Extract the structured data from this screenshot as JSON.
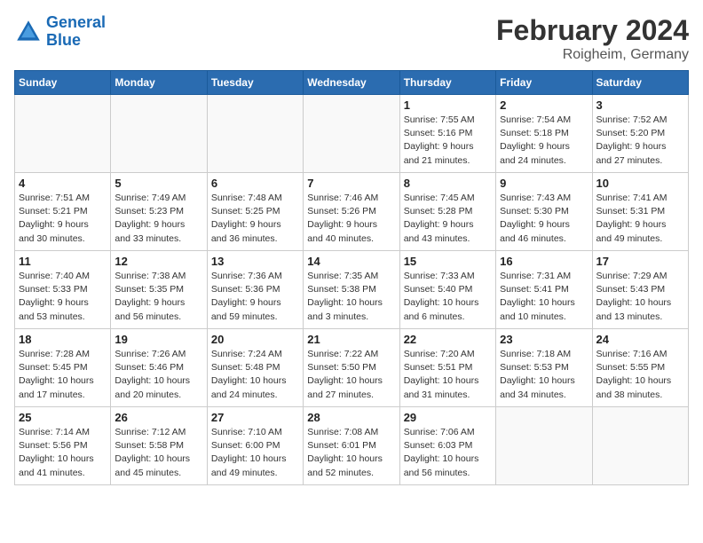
{
  "logo": {
    "line1": "General",
    "line2": "Blue"
  },
  "title": "February 2024",
  "location": "Roigheim, Germany",
  "days_of_week": [
    "Sunday",
    "Monday",
    "Tuesday",
    "Wednesday",
    "Thursday",
    "Friday",
    "Saturday"
  ],
  "weeks": [
    [
      {
        "day": "",
        "info": ""
      },
      {
        "day": "",
        "info": ""
      },
      {
        "day": "",
        "info": ""
      },
      {
        "day": "",
        "info": ""
      },
      {
        "day": "1",
        "info": "Sunrise: 7:55 AM\nSunset: 5:16 PM\nDaylight: 9 hours\nand 21 minutes."
      },
      {
        "day": "2",
        "info": "Sunrise: 7:54 AM\nSunset: 5:18 PM\nDaylight: 9 hours\nand 24 minutes."
      },
      {
        "day": "3",
        "info": "Sunrise: 7:52 AM\nSunset: 5:20 PM\nDaylight: 9 hours\nand 27 minutes."
      }
    ],
    [
      {
        "day": "4",
        "info": "Sunrise: 7:51 AM\nSunset: 5:21 PM\nDaylight: 9 hours\nand 30 minutes."
      },
      {
        "day": "5",
        "info": "Sunrise: 7:49 AM\nSunset: 5:23 PM\nDaylight: 9 hours\nand 33 minutes."
      },
      {
        "day": "6",
        "info": "Sunrise: 7:48 AM\nSunset: 5:25 PM\nDaylight: 9 hours\nand 36 minutes."
      },
      {
        "day": "7",
        "info": "Sunrise: 7:46 AM\nSunset: 5:26 PM\nDaylight: 9 hours\nand 40 minutes."
      },
      {
        "day": "8",
        "info": "Sunrise: 7:45 AM\nSunset: 5:28 PM\nDaylight: 9 hours\nand 43 minutes."
      },
      {
        "day": "9",
        "info": "Sunrise: 7:43 AM\nSunset: 5:30 PM\nDaylight: 9 hours\nand 46 minutes."
      },
      {
        "day": "10",
        "info": "Sunrise: 7:41 AM\nSunset: 5:31 PM\nDaylight: 9 hours\nand 49 minutes."
      }
    ],
    [
      {
        "day": "11",
        "info": "Sunrise: 7:40 AM\nSunset: 5:33 PM\nDaylight: 9 hours\nand 53 minutes."
      },
      {
        "day": "12",
        "info": "Sunrise: 7:38 AM\nSunset: 5:35 PM\nDaylight: 9 hours\nand 56 minutes."
      },
      {
        "day": "13",
        "info": "Sunrise: 7:36 AM\nSunset: 5:36 PM\nDaylight: 9 hours\nand 59 minutes."
      },
      {
        "day": "14",
        "info": "Sunrise: 7:35 AM\nSunset: 5:38 PM\nDaylight: 10 hours\nand 3 minutes."
      },
      {
        "day": "15",
        "info": "Sunrise: 7:33 AM\nSunset: 5:40 PM\nDaylight: 10 hours\nand 6 minutes."
      },
      {
        "day": "16",
        "info": "Sunrise: 7:31 AM\nSunset: 5:41 PM\nDaylight: 10 hours\nand 10 minutes."
      },
      {
        "day": "17",
        "info": "Sunrise: 7:29 AM\nSunset: 5:43 PM\nDaylight: 10 hours\nand 13 minutes."
      }
    ],
    [
      {
        "day": "18",
        "info": "Sunrise: 7:28 AM\nSunset: 5:45 PM\nDaylight: 10 hours\nand 17 minutes."
      },
      {
        "day": "19",
        "info": "Sunrise: 7:26 AM\nSunset: 5:46 PM\nDaylight: 10 hours\nand 20 minutes."
      },
      {
        "day": "20",
        "info": "Sunrise: 7:24 AM\nSunset: 5:48 PM\nDaylight: 10 hours\nand 24 minutes."
      },
      {
        "day": "21",
        "info": "Sunrise: 7:22 AM\nSunset: 5:50 PM\nDaylight: 10 hours\nand 27 minutes."
      },
      {
        "day": "22",
        "info": "Sunrise: 7:20 AM\nSunset: 5:51 PM\nDaylight: 10 hours\nand 31 minutes."
      },
      {
        "day": "23",
        "info": "Sunrise: 7:18 AM\nSunset: 5:53 PM\nDaylight: 10 hours\nand 34 minutes."
      },
      {
        "day": "24",
        "info": "Sunrise: 7:16 AM\nSunset: 5:55 PM\nDaylight: 10 hours\nand 38 minutes."
      }
    ],
    [
      {
        "day": "25",
        "info": "Sunrise: 7:14 AM\nSunset: 5:56 PM\nDaylight: 10 hours\nand 41 minutes."
      },
      {
        "day": "26",
        "info": "Sunrise: 7:12 AM\nSunset: 5:58 PM\nDaylight: 10 hours\nand 45 minutes."
      },
      {
        "day": "27",
        "info": "Sunrise: 7:10 AM\nSunset: 6:00 PM\nDaylight: 10 hours\nand 49 minutes."
      },
      {
        "day": "28",
        "info": "Sunrise: 7:08 AM\nSunset: 6:01 PM\nDaylight: 10 hours\nand 52 minutes."
      },
      {
        "day": "29",
        "info": "Sunrise: 7:06 AM\nSunset: 6:03 PM\nDaylight: 10 hours\nand 56 minutes."
      },
      {
        "day": "",
        "info": ""
      },
      {
        "day": "",
        "info": ""
      }
    ]
  ]
}
